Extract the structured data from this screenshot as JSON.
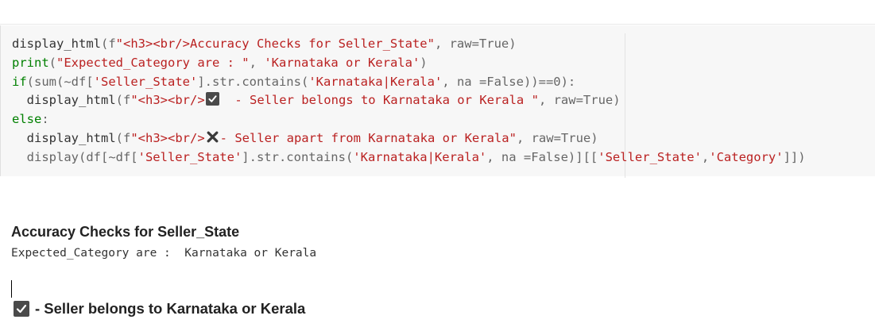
{
  "code_cell": {
    "lines": [
      [
        {
          "t": "display_html",
          "c": "fn"
        },
        {
          "t": "(f",
          "c": "op"
        },
        {
          "t": "\"<h3><br/>Accuracy Checks for Seller_State\"",
          "c": "str"
        },
        {
          "t": ", raw=True)",
          "c": "op"
        }
      ],
      [
        {
          "t": "print",
          "c": "kw"
        },
        {
          "t": "(",
          "c": "op"
        },
        {
          "t": "\"Expected_Category are : \"",
          "c": "str"
        },
        {
          "t": ", ",
          "c": "op"
        },
        {
          "t": "'Karnataka or Kerala'",
          "c": "str"
        },
        {
          "t": ")",
          "c": "op"
        }
      ],
      [
        {
          "t": "if",
          "c": "kw"
        },
        {
          "t": "(sum(~df[",
          "c": "op"
        },
        {
          "t": "'Seller_State'",
          "c": "str"
        },
        {
          "t": "].str.contains(",
          "c": "op"
        },
        {
          "t": "'Karnataka|Kerala'",
          "c": "str"
        },
        {
          "t": ", na =False))==0):",
          "c": "op"
        }
      ],
      [
        {
          "t": "  display_html",
          "c": "fn"
        },
        {
          "t": "(f",
          "c": "op"
        },
        {
          "t": "\"<h3><br/>",
          "c": "str"
        },
        {
          "icon": "check-box"
        },
        {
          "t": "  - Seller belongs to Karnataka or Kerala \"",
          "c": "str"
        },
        {
          "t": ", raw=True)",
          "c": "op"
        }
      ],
      [
        {
          "t": "else",
          "c": "kw"
        },
        {
          "t": ":",
          "c": "op"
        }
      ],
      [
        {
          "t": "  display_html",
          "c": "fn"
        },
        {
          "t": "(f",
          "c": "op"
        },
        {
          "t": "\"<h3><br/>",
          "c": "str"
        },
        {
          "icon": "cross-mark"
        },
        {
          "t": "- Seller apart from Karnataka or Kerala\"",
          "c": "str"
        },
        {
          "t": ", raw=True)",
          "c": "op"
        }
      ],
      [
        {
          "t": "  display(df[~df[",
          "c": "op"
        },
        {
          "t": "'Seller_State'",
          "c": "str"
        },
        {
          "t": "].str.contains(",
          "c": "op"
        },
        {
          "t": "'Karnataka|Kerala'",
          "c": "str"
        },
        {
          "t": ", na =False)][[",
          "c": "op"
        },
        {
          "t": "'Seller_State'",
          "c": "str"
        },
        {
          "t": ",",
          "c": "op"
        },
        {
          "t": "'Category'",
          "c": "str"
        },
        {
          "t": "]])",
          "c": "op"
        }
      ]
    ]
  },
  "output": {
    "title": "Accuracy Checks for Seller_State",
    "expected_line": "Expected_Category are :  Karnataka or Kerala",
    "result_text": "- Seller belongs to Karnataka or Kerala",
    "result_icon": "check-box-icon"
  },
  "colors": {
    "keyword": "#008000",
    "string": "#ba2121",
    "code_background": "#f7f7f7",
    "checkbox": "#4a4a4a"
  }
}
